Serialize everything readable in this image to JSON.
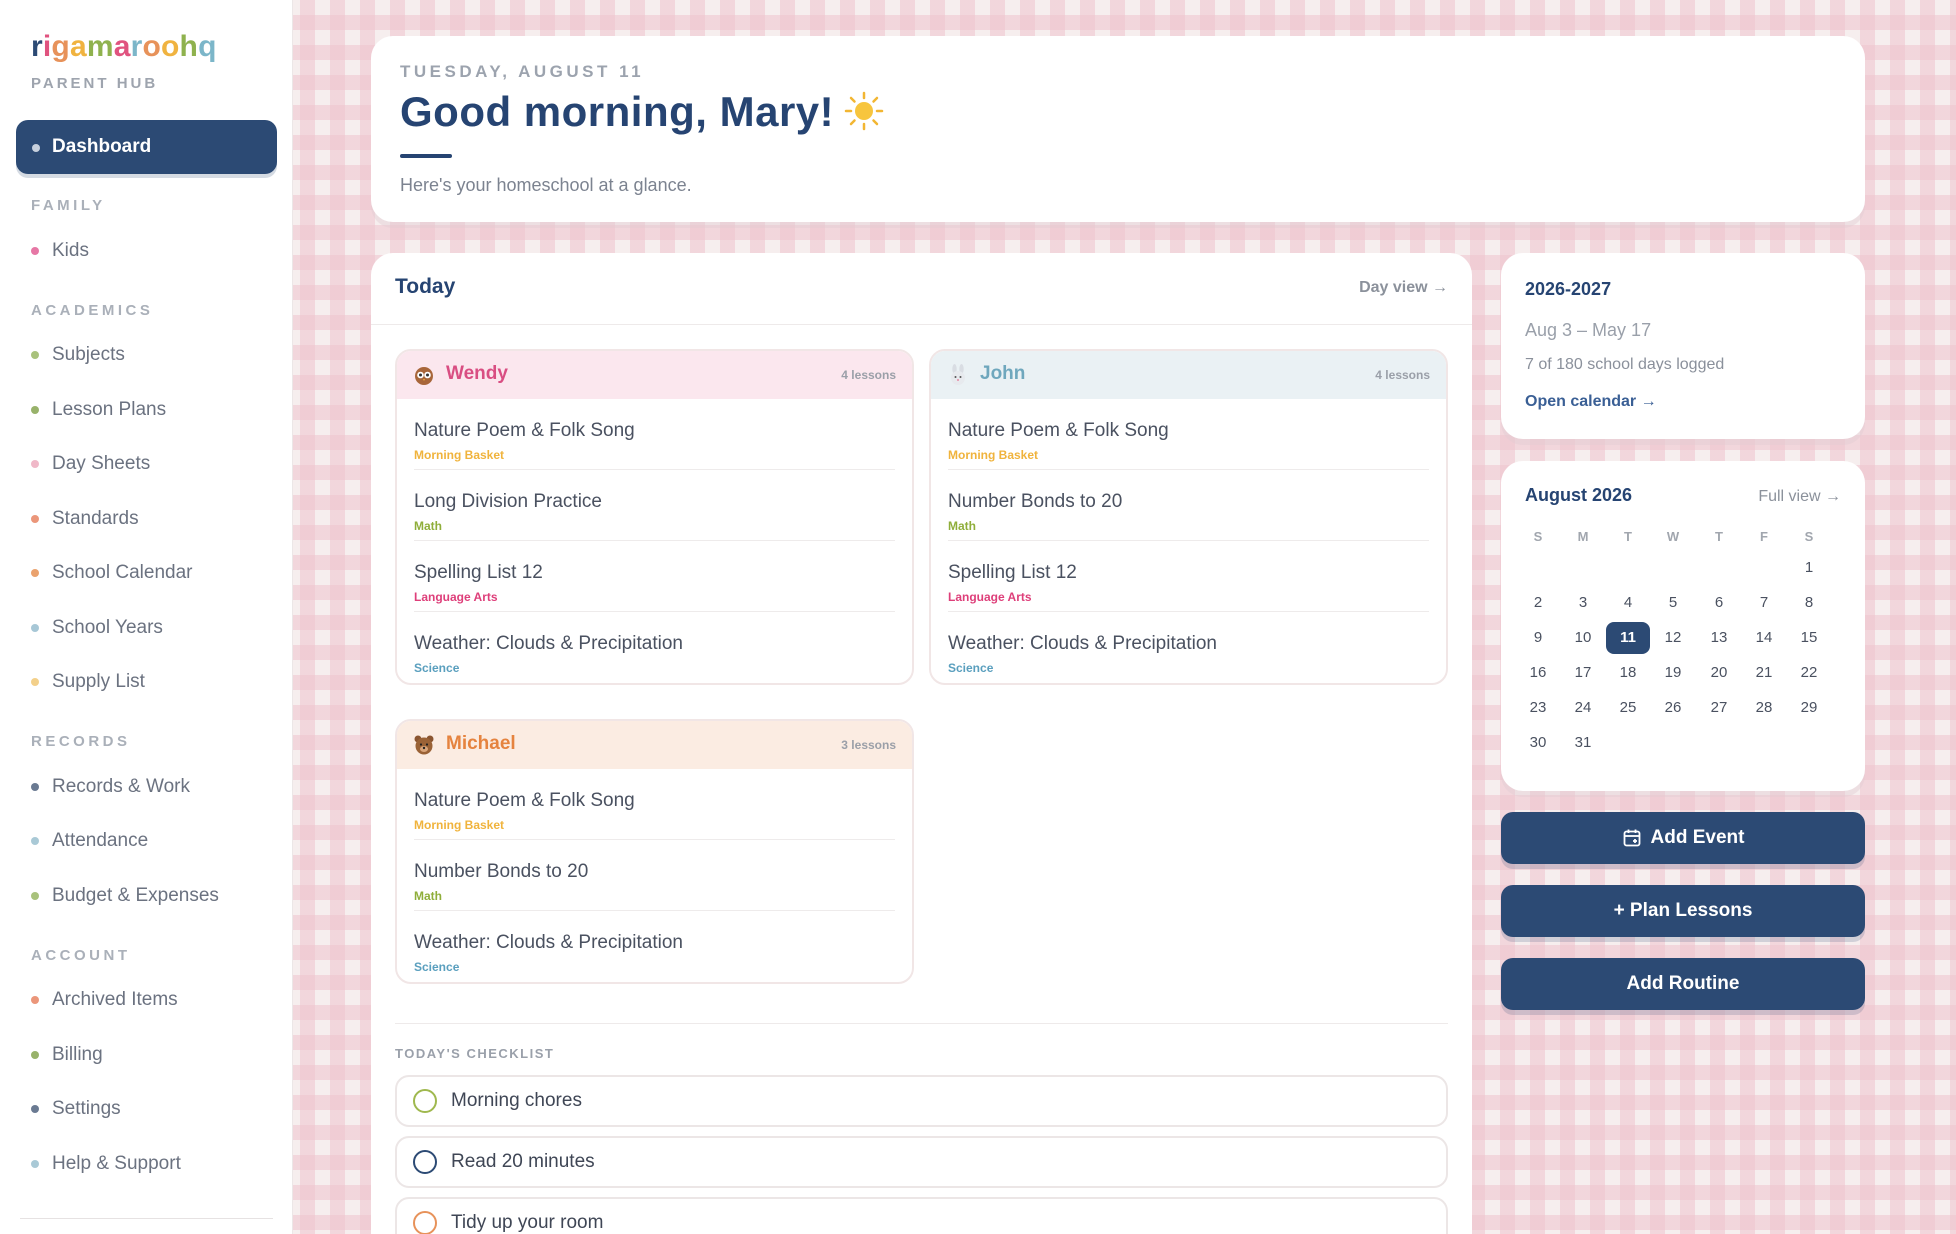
{
  "brand": {
    "logo_letters": [
      {
        "ch": "r",
        "color": "#2c4a74"
      },
      {
        "ch": "i",
        "color": "#e0537f"
      },
      {
        "ch": "g",
        "color": "#e7925a"
      },
      {
        "ch": "a",
        "color": "#f0b340"
      },
      {
        "ch": "m",
        "color": "#8fb24e"
      },
      {
        "ch": "a",
        "color": "#e0537f"
      },
      {
        "ch": "r",
        "color": "#7cb6c9"
      },
      {
        "ch": "o",
        "color": "#e7925a"
      },
      {
        "ch": "o",
        "color": "#f0b340"
      },
      {
        "ch": "h",
        "color": "#8fb24e"
      },
      {
        "ch": "q",
        "color": "#7cb6c9"
      }
    ],
    "subtitle": "PARENT HUB"
  },
  "sidebar": {
    "active_item": "Dashboard",
    "sections": {
      "family": "FAMILY",
      "academics": "ACADEMICS",
      "records": "RECORDS",
      "account": "ACCOUNT"
    },
    "items": [
      {
        "label": "Kids",
        "color": "#e677a5"
      },
      {
        "label": "Subjects",
        "color": "#a9c27c"
      },
      {
        "label": "Lesson Plans",
        "color": "#98b26a"
      },
      {
        "label": "Day Sheets",
        "color": "#f0b8c8"
      },
      {
        "label": "Standards",
        "color": "#eb967a"
      },
      {
        "label": "School Calendar",
        "color": "#eaa26e"
      },
      {
        "label": "School Years",
        "color": "#a7c7d6"
      },
      {
        "label": "Supply List",
        "color": "#f3d08a"
      },
      {
        "label": "Records & Work",
        "color": "#6a7a92"
      },
      {
        "label": "Attendance",
        "color": "#a9c9d6"
      },
      {
        "label": "Budget & Expenses",
        "color": "#a9c27c"
      },
      {
        "label": "Archived Items",
        "color": "#eb967a"
      },
      {
        "label": "Billing",
        "color": "#98b26a"
      },
      {
        "label": "Settings",
        "color": "#6a7a92"
      },
      {
        "label": "Help & Support",
        "color": "#a9c9d6"
      }
    ]
  },
  "greeting": {
    "date": "TUESDAY, AUGUST 11",
    "title": "Good morning, Mary!",
    "subtitle": "Here's your homeschool at a glance."
  },
  "today": {
    "title": "Today",
    "day_view": "Day view →",
    "kids": [
      {
        "name": "Wendy",
        "count": "4 lessons",
        "header_bg": "#fbe7ee",
        "name_color": "#d94e82",
        "avatar": "owl-avatar-icon",
        "lessons": [
          {
            "title": "Nature Poem & Folk Song",
            "subject": "Morning Basket",
            "color": "#f0b33c"
          },
          {
            "title": "Long Division Practice",
            "subject": "Math",
            "color": "#8fae3a"
          },
          {
            "title": "Spelling List 12",
            "subject": "Language Arts",
            "color": "#de3f7a"
          },
          {
            "title": "Weather: Clouds & Precipitation",
            "subject": "Science",
            "color": "#5a9fbe"
          }
        ]
      },
      {
        "name": "John",
        "count": "4 lessons",
        "header_bg": "#eaf1f4",
        "name_color": "#6fa7bd",
        "avatar": "bunny-avatar-icon",
        "lessons": [
          {
            "title": "Nature Poem & Folk Song",
            "subject": "Morning Basket",
            "color": "#f0b33c"
          },
          {
            "title": "Number Bonds to 20",
            "subject": "Math",
            "color": "#8fae3a"
          },
          {
            "title": "Spelling List 12",
            "subject": "Language Arts",
            "color": "#de3f7a"
          },
          {
            "title": "Weather: Clouds & Precipitation",
            "subject": "Science",
            "color": "#5a9fbe"
          }
        ]
      },
      {
        "name": "Michael",
        "count": "3 lessons",
        "header_bg": "#fbece2",
        "name_color": "#e5833f",
        "avatar": "bear-avatar-icon",
        "lessons": [
          {
            "title": "Nature Poem & Folk Song",
            "subject": "Morning Basket",
            "color": "#f0b33c"
          },
          {
            "title": "Number Bonds to 20",
            "subject": "Math",
            "color": "#8fae3a"
          },
          {
            "title": "Weather: Clouds & Precipitation",
            "subject": "Science",
            "color": "#5a9fbe"
          }
        ]
      }
    ],
    "checklist_label": "TODAY'S CHECKLIST",
    "checklist": [
      {
        "label": "Morning chores",
        "color": "#9fb84e"
      },
      {
        "label": "Read 20 minutes",
        "color": "#2c4a74"
      },
      {
        "label": "Tidy up your room",
        "color": "#e7925a"
      }
    ]
  },
  "school_year": {
    "title": "2026-2027",
    "range": "Aug 3 – May 17",
    "logged": "7 of 180 school days logged",
    "link": "Open calendar →"
  },
  "calendar": {
    "month": "August 2026",
    "full_view": "Full view →",
    "weekdays": [
      "S",
      "M",
      "T",
      "W",
      "T",
      "F",
      "S"
    ],
    "first_weekday": 6,
    "days_in_month": 31,
    "selected_day": 11
  },
  "actions": {
    "add_event": "Add Event",
    "plan_lessons": "+ Plan Lessons",
    "add_routine": "Add Routine"
  }
}
